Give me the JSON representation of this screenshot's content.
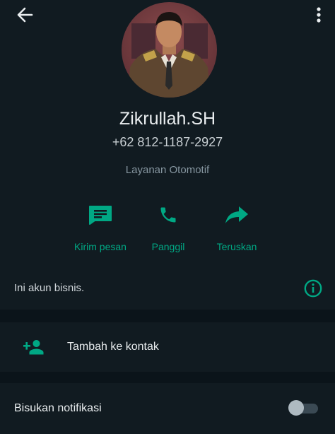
{
  "contact": {
    "name": "Zikrullah.SH",
    "phone": "+62 812-1187-2927",
    "category": "Layanan Otomotif"
  },
  "actions": [
    {
      "label": "Kirim pesan",
      "icon": "message-icon"
    },
    {
      "label": "Panggil",
      "icon": "phone-icon"
    },
    {
      "label": "Teruskan",
      "icon": "forward-icon"
    }
  ],
  "business_notice": "Ini akun bisnis.",
  "add_contact_label": "Tambah ke kontak",
  "mute_label": "Bisukan notifikasi",
  "mute_enabled": false,
  "colors": {
    "accent": "#00a884",
    "background": "#0b141a",
    "surface": "#111b21",
    "text_primary": "#e9edef",
    "text_secondary": "#8696a0"
  }
}
